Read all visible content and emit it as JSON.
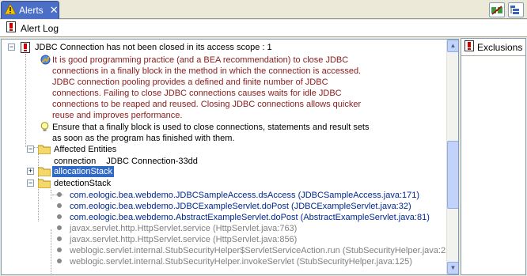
{
  "tab": {
    "label": "Alerts",
    "close": "✕"
  },
  "toolbar": {
    "alert_log_label": "Alert Log"
  },
  "exclusions": {
    "title": "Exclusions"
  },
  "tree": {
    "root_title": "JDBC Connection has not been closed in its access scope : 1",
    "description": [
      "It is good programming practice (and a BEA recommendation) to close JDBC",
      "connections in a finally block in the method in which the connection is accessed.",
      "JDBC connection pooling provides a defined and finite number of JDBC",
      "connections. Failing to close JDBC connections causes waits for idle JDBC",
      "connections to be reaped and reused. Closing JDBC connections allows quicker",
      "reuse and improves performance."
    ],
    "tip": [
      "Ensure that a finally block is used to close connections, statements and result sets",
      "as soon as the program has finished with them."
    ],
    "affected_entities": "Affected Entities",
    "connection_key": "connection",
    "connection_value": "JDBC Connection-33dd",
    "allocation_stack": "allocationStack",
    "detection_stack": "detectionStack",
    "stack_frames": [
      "com.eologic.bea.webdemo.JDBCSampleAccess.dsAccess (JDBCSampleAccess.java:171)",
      "com.eologic.bea.webdemo.JDBCExampleServlet.doPost (JDBCExampleServlet.java:32)",
      "com.eologic.bea.webdemo.AbstractExampleServlet.doPost (AbstractExampleServlet.java:81)",
      "javax.servlet.http.HttpServlet.service (HttpServlet.java:763)",
      "javax.servlet.http.HttpServlet.service (HttpServlet.java:856)",
      "weblogic.servlet.internal.StubSecurityHelper$ServletServiceAction.run (StubSecurityHelper.java:22",
      "weblogic.servlet.internal.StubSecurityHelper.invokeServlet (StubSecurityHelper.java:125)"
    ]
  },
  "colors": {
    "tab_active": "#4b6fc7",
    "description_text": "#8b1a1a",
    "app_frame_text": "#00288c",
    "library_frame_text": "#808080",
    "selection": "#316ac5"
  },
  "icons": [
    "alert-warning-icon",
    "close-icon",
    "link-toggle-icon",
    "view-menu-icon",
    "alert-log-icon",
    "error-item-icon",
    "info-icon",
    "lightbulb-icon",
    "folder-icon",
    "stack-frame-icon"
  ]
}
